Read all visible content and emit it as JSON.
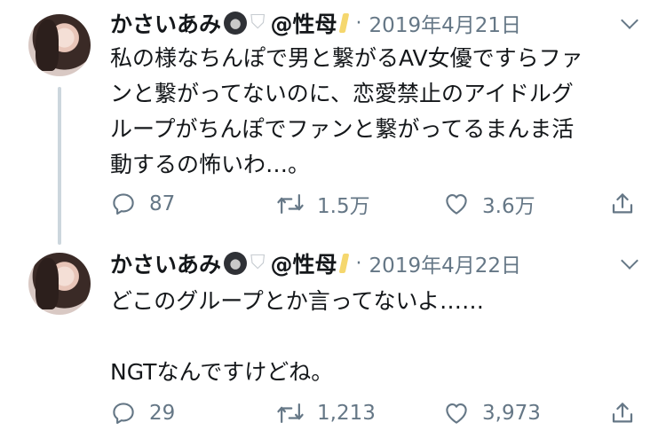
{
  "tweets": [
    {
      "display_name": "かさいあみ",
      "handle": "@性母",
      "separator": "·",
      "date": "2019年4月21日",
      "lines": [
        "私の様なちんぽで男と繋がるAV女優ですらファ",
        "ンと繋がってないのに、恋愛禁止のアイドルグ",
        "ループがちんぽでファンと繋がってるまんま活",
        "動するの怖いわ…。"
      ],
      "replies": "87",
      "retweets": "1.5万",
      "likes": "3.6万"
    },
    {
      "display_name": "かさいあみ",
      "handle": "@性母",
      "separator": "·",
      "date": "2019年4月22日",
      "lines": [
        "どこのグループとか言ってないよ……",
        "",
        "NGTなんですけどね。"
      ],
      "replies": "29",
      "retweets": "1,213",
      "likes": "3,973"
    }
  ],
  "icons": {
    "gorilla": "gorilla-emoji",
    "toilet": "toilet-emoji",
    "tag": "tag-emoji",
    "reply": "reply-icon",
    "retweet": "retweet-icon",
    "like": "like-icon",
    "share": "share-icon",
    "menu": "chevron-down-icon"
  },
  "colors": {
    "text": "#14171a",
    "muted": "#657786",
    "thread_line": "#ccd6dd"
  }
}
